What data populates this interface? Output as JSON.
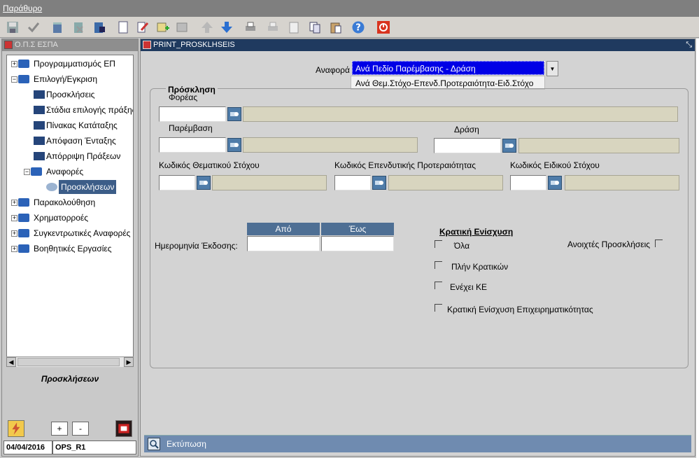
{
  "menu": {
    "title": "Παράθυρο"
  },
  "toolbar": {
    "buttons": [
      "save-icon",
      "check-icon",
      "db-icon",
      "db-delete-icon",
      "db-query-icon",
      "new-page-icon",
      "edit-pencil-icon",
      "grid-add-icon",
      "grid-icon",
      "arrow-up-icon",
      "arrow-down-icon",
      "printer-icon",
      "printer-gray-icon",
      "notes-icon",
      "copy-icon",
      "paste-icon",
      "help-icon",
      "power-icon"
    ]
  },
  "left": {
    "title": "Ο.Π.Σ ΕΣΠΑ",
    "tree": {
      "n1": "Προγραμματισμός ΕΠ",
      "n2": "Επιλογή/Εγκριση",
      "n2a": "Προσκλήσεις",
      "n2b": "Στάδια επιλογής πράξης",
      "n2c": "Πίνακας Κατάταξης",
      "n2d": "Απόφαση Ένταξης",
      "n2e": "Απόρριψη Πράξεων",
      "n2f": "Αναφορές",
      "n2f1": "Προσκλήσεων",
      "n3": "Παρακολούθηση",
      "n4": "Χρηματορροές",
      "n5": "Συγκεντρωτικές Αναφορές",
      "n6": "Βοηθητικές Εργασίες"
    },
    "caption": "Προσκλήσεων",
    "plus": "+",
    "minus": "-",
    "date": "04/04/2016",
    "user": "OPS_R1"
  },
  "form": {
    "title": "PRINT_PROSKLHSEIS",
    "report_label": "Αναφορά",
    "report_selected": "Ανά Πεδίο Παρέμβασης - Δράση",
    "report_option2": "Ανά Θεμ.Στόχο-Επενδ.Προτεραιότητα-Ειδ.Στόχο",
    "group_title": "Πρόσκληση",
    "foreas": "Φορέας",
    "paremvasi": "Παρέμβαση",
    "drasi": "Δράση",
    "thematikos": "Κωδικός Θεματικού Στόχου",
    "ependytiki": "Κωδικός Επενδυτικής Προτεραιότητας",
    "eidikos": "Κωδικός Ειδικού Στόχου",
    "date_label": "Ημερομηνία Έκδοσης:",
    "from": "Από",
    "to": "Έως",
    "state_aid_title": "Κρατική Ενίσχυση",
    "opt_all": "Όλα",
    "opt_full": "Πλήν Κρατικών",
    "opt_ke": "Ενέχει ΚΕ",
    "opt_business": "Κρατική Ενίσχυση Επιχειρηματικότητας",
    "open_calls": "Ανοιχτές Προσκλήσεις",
    "print": "Εκτύπωση"
  }
}
